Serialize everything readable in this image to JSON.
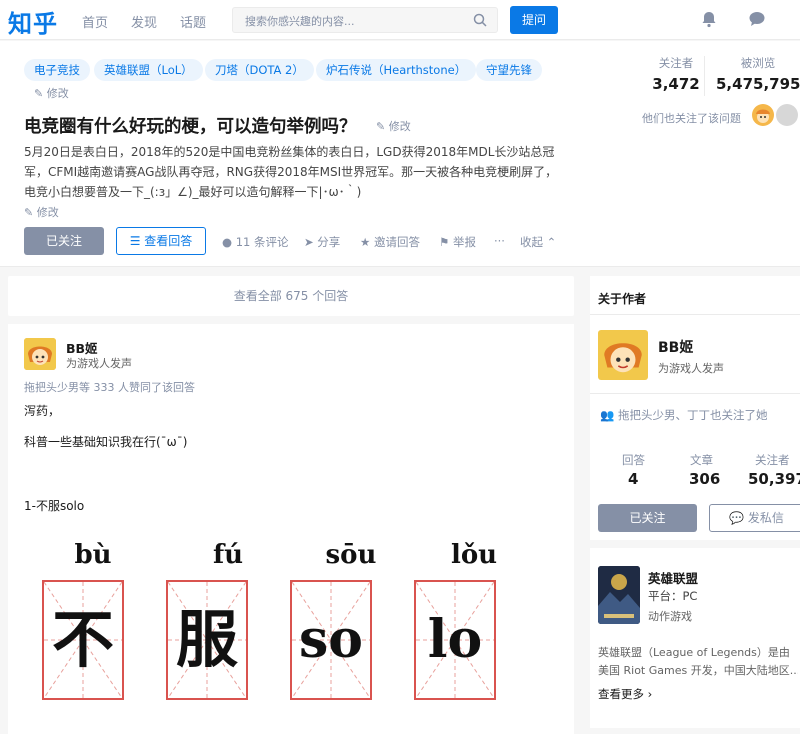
{
  "header": {
    "logo": "知乎",
    "nav": [
      "首页",
      "发现",
      "话题"
    ],
    "search_placeholder": "搜索你感兴趣的内容...",
    "ask_label": "提问"
  },
  "question": {
    "tags": [
      "电子竞技",
      "英雄联盟（LoL）",
      "刀塔（DOTA 2）",
      "炉石传说（Hearthstone）",
      "守望先锋"
    ],
    "edit_label": "修改",
    "title": "电竞圈有什么好玩的梗，可以造句举例吗？",
    "description": [
      "5月20日是表白日，2018年的520是中国电竞粉丝集体的表白日，LGD获得2018年MDL长沙站总冠",
      "军，CFMI越南邀请赛AG战队再夺冠，RNG获得2018年MSI世界冠军。那一天被各种电竞梗刷屏了，",
      "电竞小白想要普及一下_(:з」∠)_最好可以造句解释一下|･ω･｀)"
    ],
    "follow_label": "已关注",
    "view_answers_label": "查看回答",
    "actions": {
      "comments": "11 条评论",
      "share": "分享",
      "invite": "邀请回答",
      "report": "举报",
      "more": "···",
      "collapse": "收起"
    },
    "stats": {
      "followers_label": "关注者",
      "followers": "3,472",
      "views_label": "被浏览",
      "views": "5,475,795"
    },
    "also_followed": "他们也关注了该问题"
  },
  "answers": {
    "view_all": "查看全部 675 个回答",
    "author_name": "BB姬",
    "author_bio": "为游戏人发声",
    "upvote_text": "拖把头少男等 333 人赞同了该回答",
    "lines": [
      "泻药，",
      "科普一些基础知识我在行(¯ω¯)",
      "1-不服solo"
    ],
    "pinyin": [
      "bù",
      "fú",
      "sōu",
      "lǒu"
    ],
    "chars": [
      "不",
      "服",
      "so",
      "lo"
    ]
  },
  "author_card": {
    "heading": "关于作者",
    "name": "BB姬",
    "bio": "为游戏人发声",
    "mutual": "拖把头少男、丁丁也关注了她",
    "answers_label": "回答",
    "answers": "4",
    "articles_label": "文章",
    "articles": "306",
    "followers_label": "关注者",
    "followers": "50,397",
    "follow_label": "已关注",
    "message_label": "发私信"
  },
  "game_card": {
    "title": "英雄联盟",
    "platform": "平台：PC",
    "genre": "动作游戏",
    "description": [
      "英雄联盟（League of Legends）是由",
      "美国 Riot Games 开发，中国大陆地区..."
    ],
    "more_label": "查看更多"
  },
  "colors": {
    "accent": "#0a79e6",
    "muted": "#8590a6",
    "grid_red": "#d9534f"
  }
}
